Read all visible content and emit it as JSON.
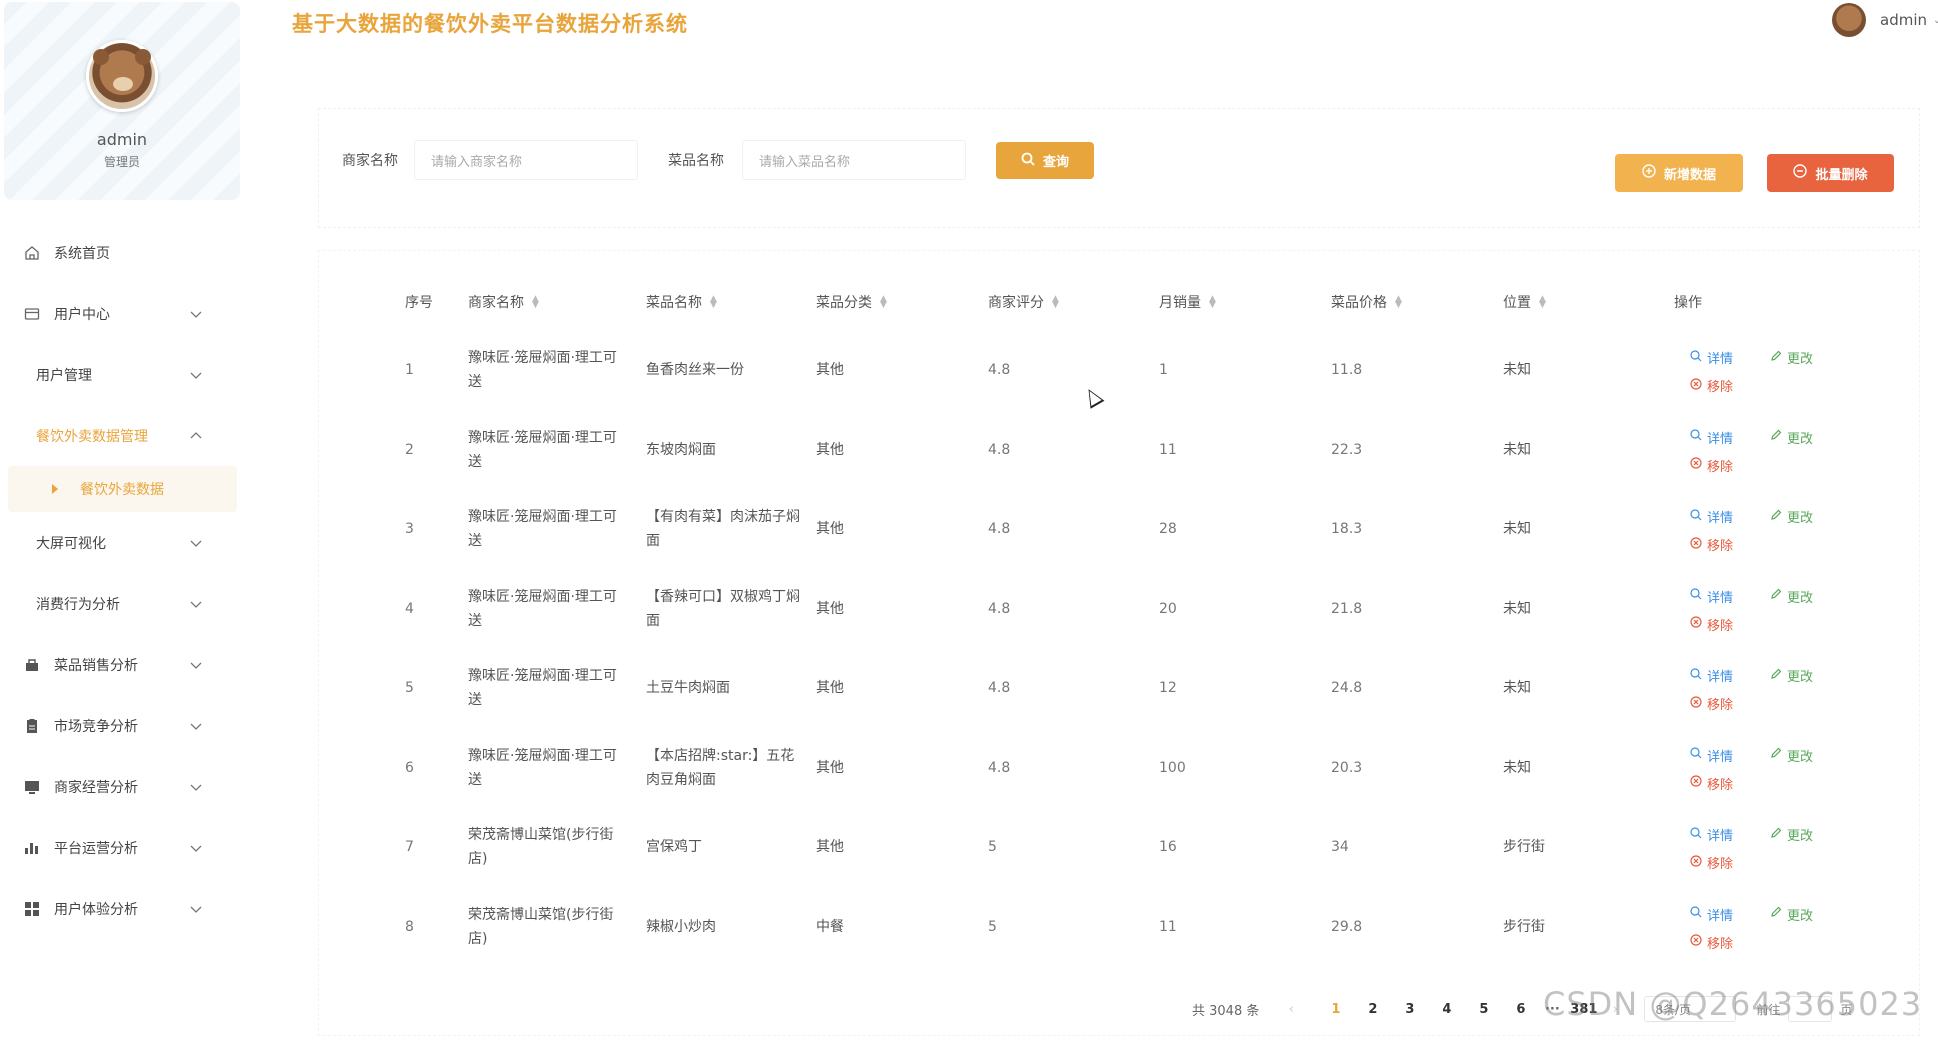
{
  "header": {
    "title": "基于大数据的餐饮外卖平台数据分析系统",
    "user_name": "admin"
  },
  "sidebar": {
    "profile_name": "admin",
    "profile_role": "管理员",
    "items": [
      {
        "label": "系统首页",
        "icon": "home-icon"
      },
      {
        "label": "用户中心",
        "icon": "user-card-icon"
      },
      {
        "label": "用户管理",
        "icon": ""
      },
      {
        "label": "餐饮外卖数据管理",
        "icon": ""
      },
      {
        "label": "餐饮外卖数据",
        "icon": "caret-right-icon"
      },
      {
        "label": "大屏可视化",
        "icon": ""
      },
      {
        "label": "消费行为分析",
        "icon": ""
      },
      {
        "label": "菜品销售分析",
        "icon": "bag-icon"
      },
      {
        "label": "市场竞争分析",
        "icon": "clipboard-icon"
      },
      {
        "label": "商家经营分析",
        "icon": "monitor-icon"
      },
      {
        "label": "平台运营分析",
        "icon": "bar-chart-icon"
      },
      {
        "label": "用户体验分析",
        "icon": "grid-icon"
      }
    ]
  },
  "search": {
    "merchant_label": "商家名称",
    "merchant_placeholder": "请输入商家名称",
    "dish_label": "菜品名称",
    "dish_placeholder": "请输入菜品名称",
    "query_label": "查询",
    "add_label": "新增数据",
    "batch_delete_label": "批量删除"
  },
  "table": {
    "headers": [
      "序号",
      "商家名称",
      "菜品名称",
      "菜品分类",
      "商家评分",
      "月销量",
      "菜品价格",
      "位置",
      "操作"
    ],
    "actions": {
      "detail": "详情",
      "edit": "更改",
      "remove": "移除"
    },
    "rows": [
      {
        "index": "1",
        "merchant": "豫味匠·笼屉焖面·理工可送",
        "dish": "鱼香肉丝来一份",
        "category": "其他",
        "rating": "4.8",
        "monthly_sales": "1",
        "price": "11.8",
        "location": "未知"
      },
      {
        "index": "2",
        "merchant": "豫味匠·笼屉焖面·理工可送",
        "dish": "东坡肉焖面",
        "category": "其他",
        "rating": "4.8",
        "monthly_sales": "11",
        "price": "22.3",
        "location": "未知"
      },
      {
        "index": "3",
        "merchant": "豫味匠·笼屉焖面·理工可送",
        "dish": "【有肉有菜】肉沫茄子焖面",
        "category": "其他",
        "rating": "4.8",
        "monthly_sales": "28",
        "price": "18.3",
        "location": "未知"
      },
      {
        "index": "4",
        "merchant": "豫味匠·笼屉焖面·理工可送",
        "dish": "【香辣可口】双椒鸡丁焖面",
        "category": "其他",
        "rating": "4.8",
        "monthly_sales": "20",
        "price": "21.8",
        "location": "未知"
      },
      {
        "index": "5",
        "merchant": "豫味匠·笼屉焖面·理工可送",
        "dish": "土豆牛肉焖面",
        "category": "其他",
        "rating": "4.8",
        "monthly_sales": "12",
        "price": "24.8",
        "location": "未知"
      },
      {
        "index": "6",
        "merchant": "豫味匠·笼屉焖面·理工可送",
        "dish": "【本店招牌:star:】五花肉豆角焖面",
        "category": "其他",
        "rating": "4.8",
        "monthly_sales": "100",
        "price": "20.3",
        "location": "未知"
      },
      {
        "index": "7",
        "merchant": "荣茂斋博山菜馆(步行街店)",
        "dish": "宫保鸡丁",
        "category": "其他",
        "rating": "5",
        "monthly_sales": "16",
        "price": "34",
        "location": "步行街"
      },
      {
        "index": "8",
        "merchant": "荣茂斋博山菜馆(步行街店)",
        "dish": "辣椒小炒肉",
        "category": "中餐",
        "rating": "5",
        "monthly_sales": "11",
        "price": "29.8",
        "location": "步行街"
      }
    ]
  },
  "pagination": {
    "total": "共 3048 条",
    "pages": [
      "1",
      "2",
      "3",
      "4",
      "5",
      "6"
    ],
    "ellipsis": "···",
    "last_page": "381",
    "page_size": "8条/页",
    "jump_label": "前往",
    "page_suffix": "页"
  },
  "watermark": "CSDN @Q2643365023",
  "colors": {
    "accent": "#e8a53c",
    "danger": "#e8643f",
    "detail": "#3a8ee6",
    "edit": "#58a85a"
  }
}
